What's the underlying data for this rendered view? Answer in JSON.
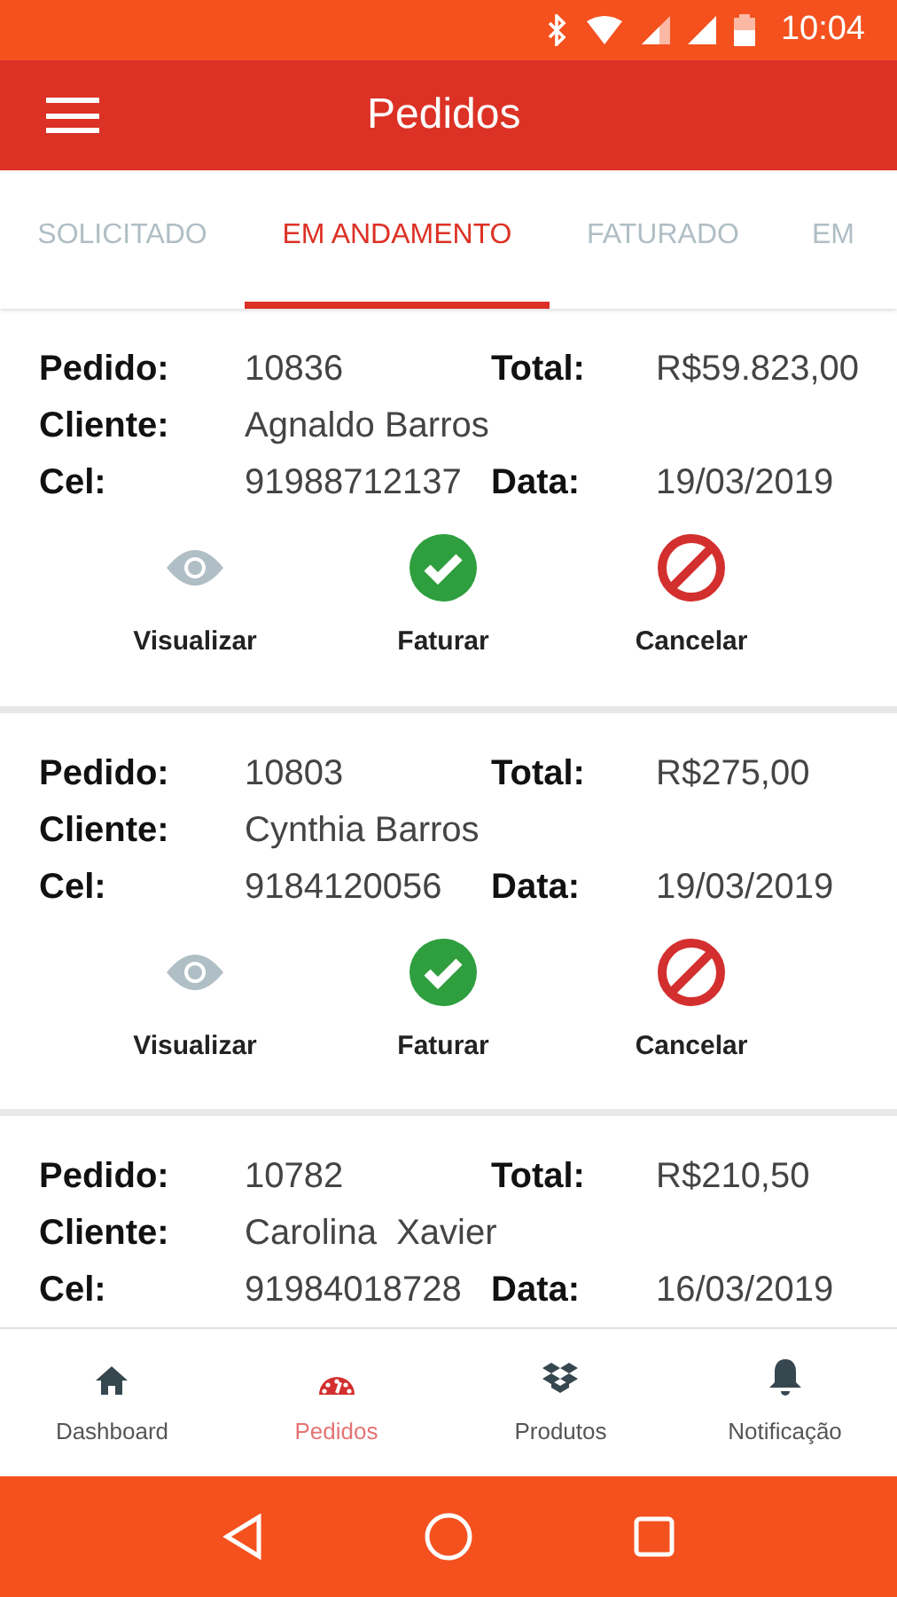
{
  "status_bar": {
    "time": "10:04"
  },
  "toolbar": {
    "title": "Pedidos"
  },
  "tabs": [
    {
      "label": "SOLICITADO",
      "selected": false
    },
    {
      "label": "EM ANDAMENTO",
      "selected": true
    },
    {
      "label": "FATURADO",
      "selected": false
    },
    {
      "label": "EM",
      "selected": false
    }
  ],
  "orders": [
    {
      "rows": [
        [
          {
            "label": "Pedido:",
            "value": "10836"
          },
          {
            "label": "Total:",
            "value": "R$59.823,00"
          }
        ],
        [
          {
            "label": "Cliente:",
            "value": "Agnaldo Barros"
          }
        ],
        [
          {
            "label": "Cel:",
            "value": "91988712137"
          },
          {
            "label": "Data:",
            "value": "19/03/2019"
          }
        ]
      ],
      "actions": [
        {
          "kind": "view",
          "label": "Visualizar"
        },
        {
          "kind": "invoice",
          "label": "Faturar"
        },
        {
          "kind": "cancel",
          "label": "Cancelar"
        }
      ]
    },
    {
      "rows": [
        [
          {
            "label": "Pedido:",
            "value": "10803"
          },
          {
            "label": "Total:",
            "value": "R$275,00"
          }
        ],
        [
          {
            "label": "Cliente:",
            "value": "Cynthia Barros"
          }
        ],
        [
          {
            "label": "Cel:",
            "value": "9184120056"
          },
          {
            "label": "Data:",
            "value": "19/03/2019"
          }
        ]
      ],
      "actions": [
        {
          "kind": "view",
          "label": "Visualizar"
        },
        {
          "kind": "invoice",
          "label": "Faturar"
        },
        {
          "kind": "cancel",
          "label": "Cancelar"
        }
      ]
    },
    {
      "rows": [
        [
          {
            "label": "Pedido:",
            "value": "10782"
          },
          {
            "label": "Total:",
            "value": "R$210,50"
          }
        ],
        [
          {
            "label": "Cliente:",
            "value": "Carolina  Xavier"
          }
        ],
        [
          {
            "label": "Cel:",
            "value": "91984018728"
          },
          {
            "label": "Data:",
            "value": "16/03/2019"
          }
        ]
      ]
    }
  ],
  "bottom_nav": [
    {
      "kind": "home",
      "label": "Dashboard",
      "selected": false
    },
    {
      "kind": "gauge",
      "label": "Pedidos",
      "selected": true
    },
    {
      "kind": "boxes",
      "label": "Produtos",
      "selected": false
    },
    {
      "kind": "bell",
      "label": "Notificação",
      "selected": false
    }
  ]
}
